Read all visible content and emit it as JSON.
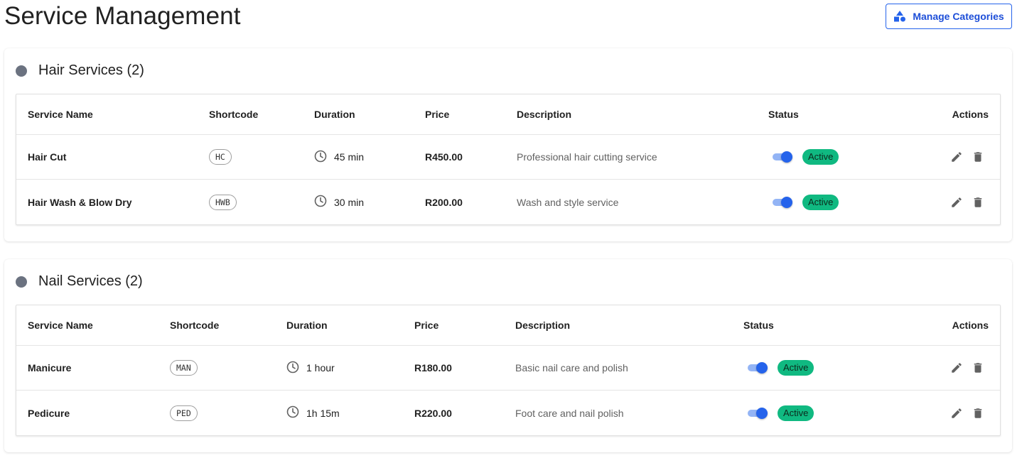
{
  "page": {
    "title": "Service Management"
  },
  "header": {
    "manage_categories_label": "Manage Categories",
    "manage_icon": "category-shapes-icon"
  },
  "table_headers": {
    "service_name": "Service Name",
    "shortcode": "Shortcode",
    "duration": "Duration",
    "price": "Price",
    "description": "Description",
    "status": "Status",
    "actions": "Actions"
  },
  "categories": [
    {
      "title": "Hair Services (2)",
      "dot_color": "#6b7280",
      "services": [
        {
          "name": "Hair Cut",
          "shortcode": "HC",
          "duration": "45 min",
          "price": "R450.00",
          "description": "Professional hair cutting service",
          "status": "Active",
          "enabled": true
        },
        {
          "name": "Hair Wash & Blow Dry",
          "shortcode": "HWB",
          "duration": "30 min",
          "price": "R200.00",
          "description": "Wash and style service",
          "status": "Active",
          "enabled": true
        }
      ]
    },
    {
      "title": "Nail Services (2)",
      "dot_color": "#6b7280",
      "services": [
        {
          "name": "Manicure",
          "shortcode": "MAN",
          "duration": "1 hour",
          "price": "R180.00",
          "description": "Basic nail care and polish",
          "status": "Active",
          "enabled": true
        },
        {
          "name": "Pedicure",
          "shortcode": "PED",
          "duration": "1h 15m",
          "price": "R220.00",
          "description": "Foot care and nail polish",
          "status": "Active",
          "enabled": true
        }
      ]
    }
  ],
  "colors": {
    "accent": "#2563eb",
    "active_badge": "#10b981",
    "switch_track": "#93b4f5"
  },
  "icons": {
    "clock": "clock-icon",
    "edit": "pencil-icon",
    "delete": "trash-icon"
  }
}
